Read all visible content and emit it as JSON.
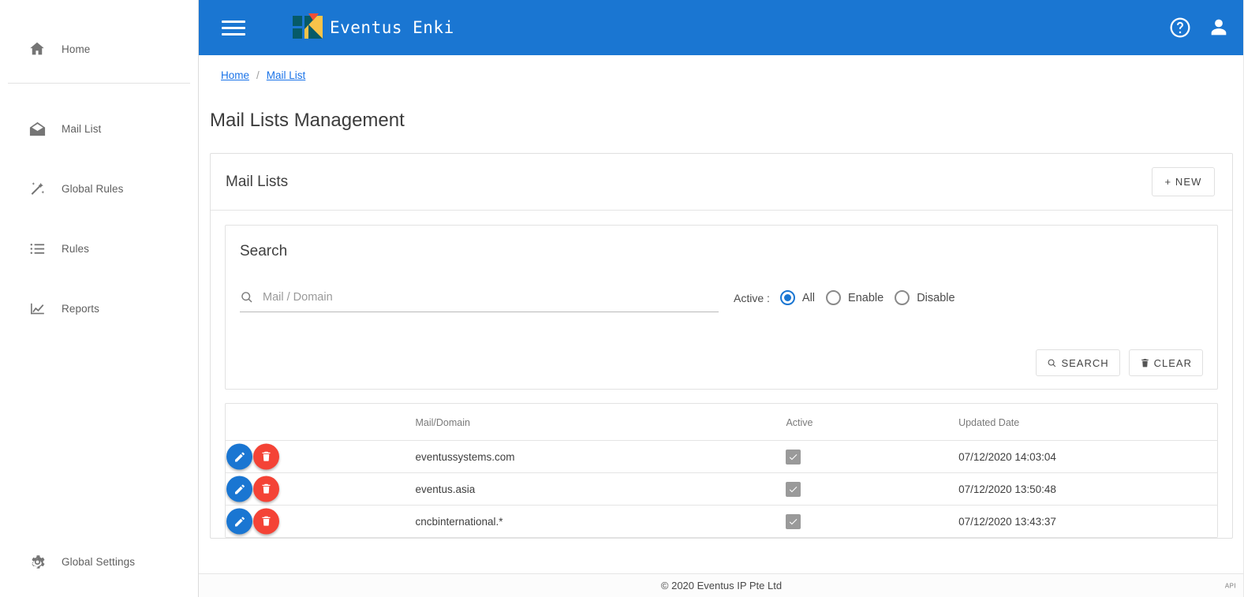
{
  "app": {
    "brand_name": "Eventus Enki",
    "accent_color": "#1a76d2",
    "danger_color": "#f44336",
    "link_color": "#1a73e8"
  },
  "topbar": {
    "menu_icon": "hamburger-menu-icon",
    "logo_icon": "eventus-enki-logo",
    "help_icon": "help-circle-icon",
    "account_icon": "user-account-icon"
  },
  "sidebar": {
    "items": [
      {
        "label": "Home",
        "icon": "home-icon"
      },
      {
        "label": "Mail List",
        "icon": "mail-open-icon"
      },
      {
        "label": "Global Rules",
        "icon": "magic-wand-icon"
      },
      {
        "label": "Rules",
        "icon": "list-icon"
      },
      {
        "label": "Reports",
        "icon": "chart-line-icon"
      }
    ],
    "bottom_item": {
      "label": "Global Settings",
      "icon": "gear-icon"
    }
  },
  "breadcrumb": {
    "items": [
      "Home",
      "Mail List"
    ],
    "separator": "/"
  },
  "page": {
    "title": "Mail Lists Management"
  },
  "card": {
    "title": "Mail Lists",
    "new_label": "+ NEW"
  },
  "search": {
    "heading": "Search",
    "input_value": "",
    "placeholder": "Mail / Domain",
    "search_icon": "search-icon",
    "active_label": "Active :",
    "options": [
      {
        "label": "All",
        "selected": true
      },
      {
        "label": "Enable",
        "selected": false
      },
      {
        "label": "Disable",
        "selected": false
      }
    ],
    "search_button": "SEARCH",
    "clear_button": "CLEAR",
    "search_button_icon": "search-icon",
    "clear_button_icon": "trash-icon"
  },
  "table": {
    "columns": [
      "",
      "Mail/Domain",
      "Active",
      "Updated Date"
    ],
    "rows": [
      {
        "domain": "eventussystems.com",
        "active": true,
        "updated": "07/12/2020 14:03:04"
      },
      {
        "domain": "eventus.asia",
        "active": true,
        "updated": "07/12/2020 13:50:48"
      },
      {
        "domain": "cncbinternational.*",
        "active": true,
        "updated": "07/12/2020 13:43:37"
      }
    ],
    "edit_icon": "pencil-icon",
    "delete_icon": "trash-icon",
    "check_icon": "check-icon"
  },
  "footer": {
    "copyright": "© 2020 Eventus IP Pte Ltd",
    "api_label": "API"
  }
}
